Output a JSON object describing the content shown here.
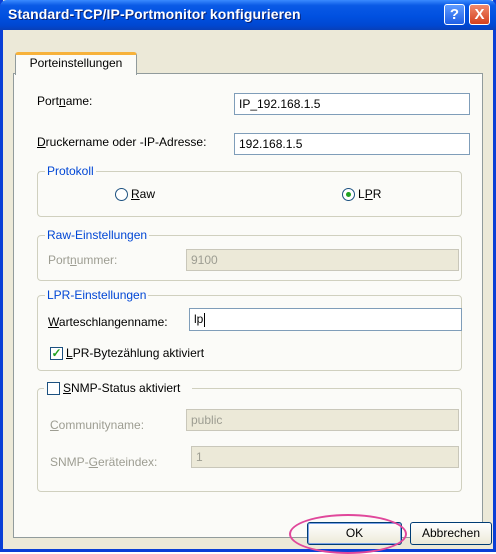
{
  "window": {
    "title": "Standard-TCP/IP-Portmonitor konfigurieren",
    "help_label": "?",
    "close_label": "X"
  },
  "tabs": [
    {
      "label": "Porteinstellungen",
      "selected": true
    }
  ],
  "port_name": {
    "label_pre": "Port",
    "label_u": "n",
    "label_post": "ame:",
    "value": "IP_192.168.1.5"
  },
  "printer_address": {
    "label_u": "D",
    "label_post": "ruckername oder -IP-Adresse:",
    "value": "192.168.1.5"
  },
  "protocol": {
    "legend": "Protokoll",
    "raw": {
      "label_u": "R",
      "label_post": "aw",
      "selected": false
    },
    "lpr": {
      "label_pre": "L",
      "label_u": "P",
      "label_post": "R",
      "selected": true
    }
  },
  "raw_settings": {
    "legend": "Raw-Einstellungen",
    "port_number": {
      "label_pre": "Port",
      "label_u": "n",
      "label_post": "ummer:",
      "value": "9100"
    }
  },
  "lpr_settings": {
    "legend": "LPR-Einstellungen",
    "queue_name": {
      "label_u": "W",
      "label_post": "arteschlangenname:",
      "value": "lp"
    },
    "byte_counting": {
      "label_u": "L",
      "label_post": "PR-Bytezählung aktiviert",
      "checked": true
    }
  },
  "snmp": {
    "status": {
      "label_u": "S",
      "label_post": "NMP-Status aktiviert",
      "checked": false
    },
    "community": {
      "label_u": "C",
      "label_post": "ommunityname:",
      "value": "public"
    },
    "device_index": {
      "label_pre": "SNMP-",
      "label_u": "G",
      "label_post": "eräteindex:",
      "value": "1"
    }
  },
  "buttons": {
    "ok": "OK",
    "cancel": "Abbrechen"
  },
  "colors": {
    "title_bar": "#0050e0",
    "group_legend": "#0046d5",
    "highlight_circle": "#e0479b",
    "tab_accent": "#f7b23b"
  }
}
